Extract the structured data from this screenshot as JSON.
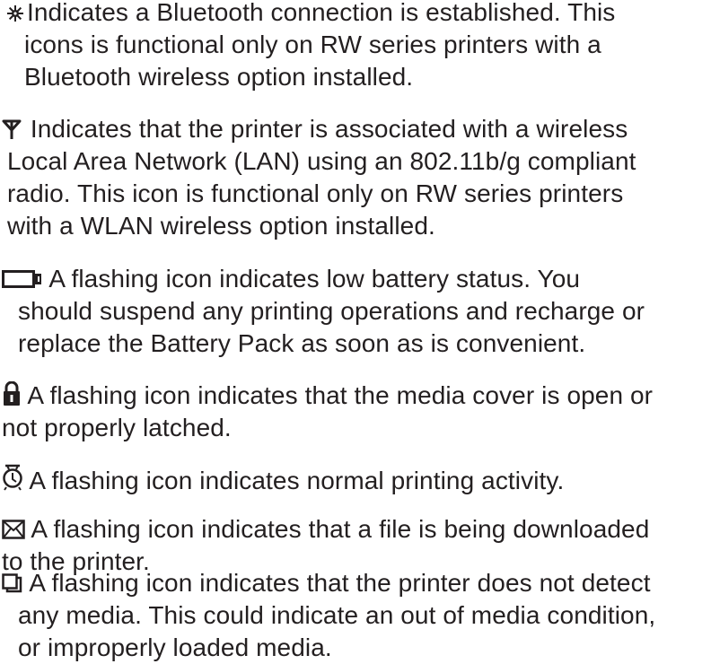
{
  "entries": [
    {
      "icon": "bluetooth-icon",
      "lines": [
        "Indicates a Bluetooth connection is established. This",
        "icons is functional only on RW series printers with a",
        "Bluetooth wireless option installed."
      ]
    },
    {
      "icon": "antenna-icon",
      "lines": [
        " Indicates that the printer is associated with a wireless",
        "Local Area Network (LAN) using an 802.11b/g compliant",
        "radio.  This icon is functional only on RW series printers",
        "with a WLAN wireless option installed."
      ]
    },
    {
      "icon": "battery-icon",
      "lines": [
        " A flashing icon indicates low battery status.  You",
        "should suspend any printing operations and recharge or",
        "replace the Battery Pack as soon as is convenient."
      ]
    },
    {
      "icon": "padlock-icon",
      "lines": [
        "  A flashing icon indicates that the media cover is open or",
        "not properly latched."
      ]
    },
    {
      "icon": "alarm-clock-icon",
      "lines": [
        "  A flashing icon indicates normal printing activity."
      ]
    },
    {
      "icon": "envelope-icon",
      "lines": [
        "  A flashing icon indicates that a file is being downloaded",
        "to the printer."
      ]
    },
    {
      "icon": "no-media-icon",
      "lines": [
        "  A flashing icon indicates that the printer does not detect",
        "any media.  This could indicate an out of media condition,",
        "or improperly loaded media."
      ]
    }
  ]
}
